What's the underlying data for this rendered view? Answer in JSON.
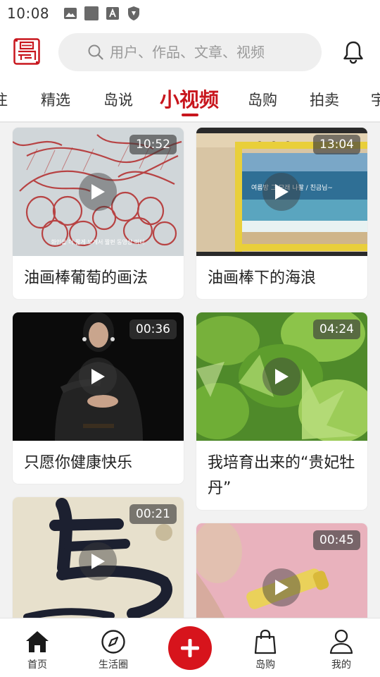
{
  "status_bar": {
    "time": "10:08",
    "icons": [
      "gallery-icon",
      "square-icon",
      "font-a-icon",
      "shield-icon"
    ]
  },
  "header": {
    "logo_icon": "dao-seal-logo-icon",
    "search_placeholder": "用户、作品、文章、视频",
    "notification_icon": "bell-icon"
  },
  "tabs": [
    {
      "label": "注",
      "active": false
    },
    {
      "label": "精选",
      "active": false
    },
    {
      "label": "岛说",
      "active": false
    },
    {
      "label": "小视频",
      "active": true
    },
    {
      "label": "岛购",
      "active": false
    },
    {
      "label": "拍卖",
      "active": false
    },
    {
      "label": "宇",
      "active": false
    }
  ],
  "videos": [
    {
      "duration": "10:52",
      "title": "油画棒葡萄的画法",
      "thumb_caption": "화인을 더 짧게 보게서 짧편 동영상 미디"
    },
    {
      "duration": "13:04",
      "title": "油画棒下的海浪",
      "thumb_caption": "여름방 그 모래 나팔 / 친금님~"
    },
    {
      "duration": "00:36",
      "title": "只愿你健康快乐"
    },
    {
      "duration": "04:24",
      "title": "我培育出来的“贵妃牡丹”"
    },
    {
      "duration": "00:21",
      "title": ""
    },
    {
      "duration": "00:45",
      "title": ""
    }
  ],
  "bottom_nav": {
    "home": "首页",
    "life_circle": "生活圈",
    "post_icon": "plus-icon",
    "shop": "岛购",
    "mine": "我的"
  },
  "colors": {
    "brand_red": "#c8161d",
    "post_button": "#d7141c",
    "page_bg": "#f2f2f2"
  }
}
